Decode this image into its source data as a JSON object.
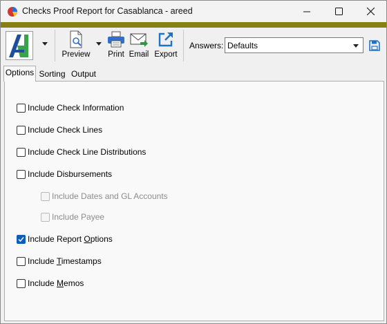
{
  "window": {
    "title": "Checks Proof Report for Casablanca - areed",
    "accent_color": "#868113"
  },
  "toolbar": {
    "preview_label": "Preview",
    "print_label": "Print",
    "email_label": "Email",
    "export_label": "Export",
    "answers_label": "Answers:",
    "answers_value": "Defaults"
  },
  "tabs": [
    {
      "label": "Options",
      "active": true
    },
    {
      "label": "Sorting",
      "active": false
    },
    {
      "label": "Output",
      "active": false
    }
  ],
  "options": [
    {
      "label": "Include Check Information",
      "checked": false,
      "enabled": true
    },
    {
      "label": "Include Check Lines",
      "checked": false,
      "enabled": true
    },
    {
      "label": "Include Check Line Distributions",
      "checked": false,
      "enabled": true
    },
    {
      "label": "Include Disbursements",
      "checked": false,
      "enabled": true
    },
    {
      "label": "Include Dates and GL Accounts",
      "checked": false,
      "enabled": false
    },
    {
      "label": "Include Payee",
      "checked": false,
      "enabled": false
    },
    {
      "label_pre": "Include Report ",
      "label_u": "O",
      "label_post": "ptions",
      "checked": true,
      "enabled": true
    },
    {
      "label_pre": "Include ",
      "label_u": "T",
      "label_post": "imestamps",
      "checked": false,
      "enabled": true
    },
    {
      "label_pre": "Include ",
      "label_u": "M",
      "label_post": "emos",
      "checked": false,
      "enabled": true
    }
  ]
}
